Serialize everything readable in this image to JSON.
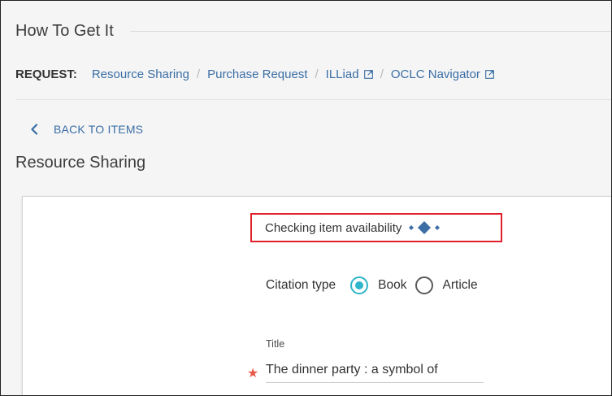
{
  "section": {
    "title": "How To Get It"
  },
  "request": {
    "label": "REQUEST:",
    "links": [
      {
        "label": "Resource Sharing"
      },
      {
        "label": "Purchase Request"
      },
      {
        "label": "ILLiad"
      },
      {
        "label": "OCLC Navigator"
      }
    ],
    "separator": "/"
  },
  "back": {
    "label": "BACK TO ITEMS"
  },
  "form": {
    "title": "Resource Sharing",
    "availability_text": "Checking item availability",
    "citation": {
      "label": "Citation type",
      "options": [
        {
          "label": "Book",
          "selected": true
        },
        {
          "label": "Article",
          "selected": false
        }
      ]
    },
    "title_field": {
      "label": "Title",
      "required_mark": "★",
      "value": "The dinner party : a symbol of"
    }
  },
  "colors": {
    "link": "#3a6ea5",
    "radio_accent": "#2eb5c9",
    "highlight_border": "#e0202a",
    "required": "#e8594a"
  }
}
